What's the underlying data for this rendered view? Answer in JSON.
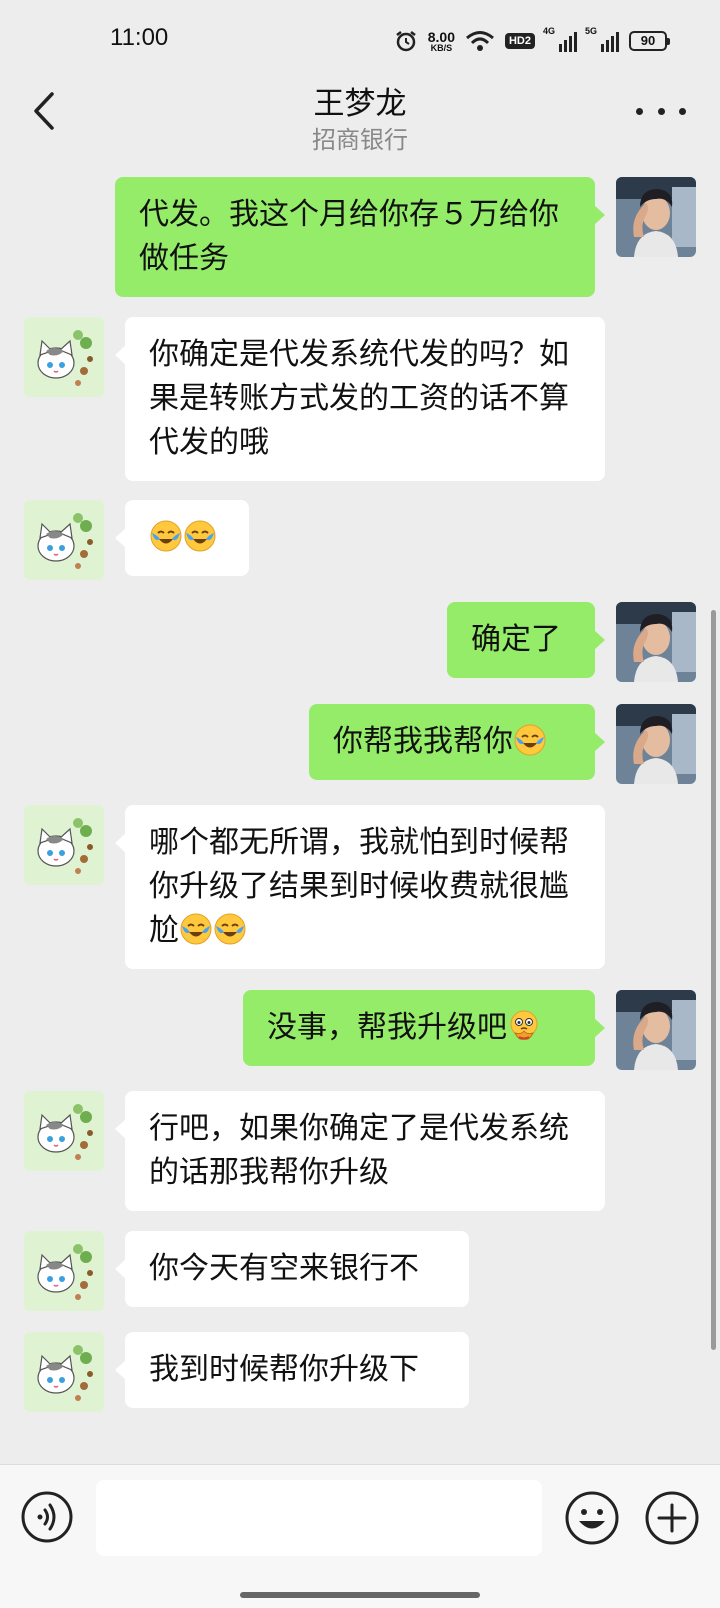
{
  "status_bar": {
    "time": "11:00",
    "net_speed_value": "8.00",
    "net_speed_unit": "KB/S",
    "hd_label": "HD2",
    "signal_1_label": "4G",
    "signal_2_label": "5G",
    "battery": "90"
  },
  "header": {
    "title": "王梦龙",
    "subtitle": "招商银行"
  },
  "messages": [
    {
      "side": "right",
      "text": "代发。我这个月给你存５万给你做任务",
      "emojis": []
    },
    {
      "side": "left",
      "text": "你确定是代发系统代发的吗？如果是转账方式发的工资的话不算代发的哦",
      "emojis": []
    },
    {
      "side": "left",
      "text": "",
      "emojis": [
        "crying-laughing-emoji",
        "crying-laughing-emoji"
      ]
    },
    {
      "side": "right",
      "text": "确定了",
      "emojis": []
    },
    {
      "side": "right",
      "text": "你帮我我帮你",
      "emojis": [
        "crying-laughing-emoji"
      ]
    },
    {
      "side": "left",
      "text": "哪个都无所谓，我就怕到时候帮你升级了结果到时候收费就很尴尬",
      "emojis": [
        "crying-laughing-emoji",
        "crying-laughing-emoji"
      ]
    },
    {
      "side": "right",
      "text": "没事，帮我升级吧",
      "emojis": [
        "pleading-hands-emoji"
      ]
    },
    {
      "side": "left",
      "text": "行吧，如果你确定了是代发系统的话那我帮你升级",
      "emojis": []
    },
    {
      "side": "left",
      "text": "你今天有空来银行不",
      "emojis": []
    },
    {
      "side": "left",
      "text": "我到时候帮你升级下",
      "emojis": []
    }
  ],
  "input": {
    "value": "",
    "placeholder": ""
  },
  "icons": {
    "back": "back-arrow-icon",
    "more": "more-dots-icon",
    "voice": "voice-icon",
    "emoji": "emoji-icon",
    "plus": "plus-icon"
  },
  "colors": {
    "background": "#ededed",
    "sent_bubble": "#95ec69",
    "received_bubble": "#ffffff"
  }
}
